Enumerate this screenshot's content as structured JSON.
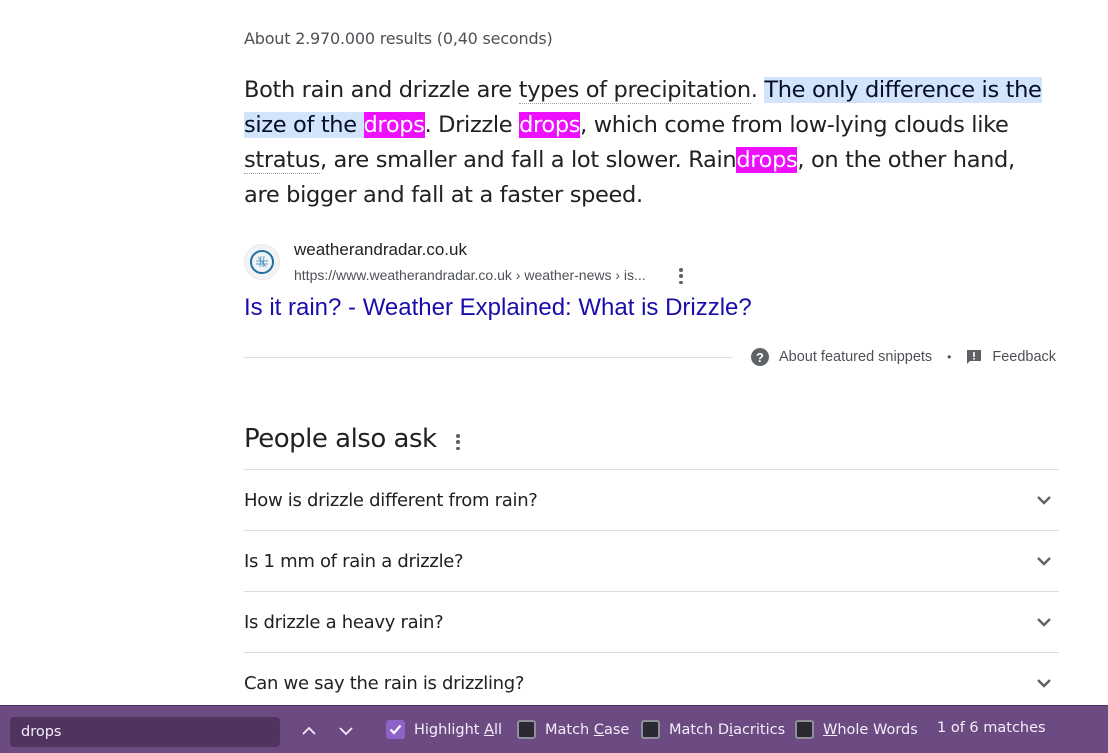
{
  "results_count": "About 2.970.000 results (0,40 seconds)",
  "snippet": {
    "segments": [
      "Both rain and drizzle are ",
      "types of precipitation",
      ". ",
      "The only difference is the size of the ",
      "drops",
      ". Drizzle ",
      "drops",
      ", which come from low-lying clouds like ",
      "stratus",
      ", are smaller and fall a lot slower. Rain",
      "drops",
      ", on the other hand, are bigger and fall at a faster speed."
    ]
  },
  "source": {
    "favicon": "weather-globe-icon",
    "site_name": "weatherandradar.co.uk",
    "url": "https://www.weatherandradar.co.uk › weather-news › is...",
    "title": "Is it rain? - Weather Explained: What is Drizzle?"
  },
  "snippet_footer": {
    "about_label": "About featured snippets",
    "separator": "•",
    "feedback_label": "Feedback"
  },
  "people_also_ask": {
    "title": "People also ask",
    "questions": [
      "How is drizzle different from rain?",
      "Is 1 mm of rain a drizzle?",
      "Is drizzle a heavy rain?",
      "Can we say the rain is drizzling?"
    ]
  },
  "find_bar": {
    "query": "drops",
    "options": {
      "highlight_all": {
        "pre": "Highlight ",
        "key": "A",
        "post": "ll",
        "checked": true
      },
      "match_case": {
        "pre": "Match ",
        "key": "C",
        "post": "ase",
        "checked": false
      },
      "match_diacritics": {
        "pre": "Match D",
        "key": "i",
        "post": "acritics",
        "checked": false
      },
      "whole_words": {
        "pre": "",
        "key": "W",
        "post": "hole Words",
        "checked": false
      }
    },
    "match_count": "1 of 6 matches"
  },
  "colors": {
    "find_highlight": "#ef0fff",
    "selection": "#d2e3fc",
    "link": "#1a0dab",
    "findbar_bg": "#6c4b82"
  }
}
